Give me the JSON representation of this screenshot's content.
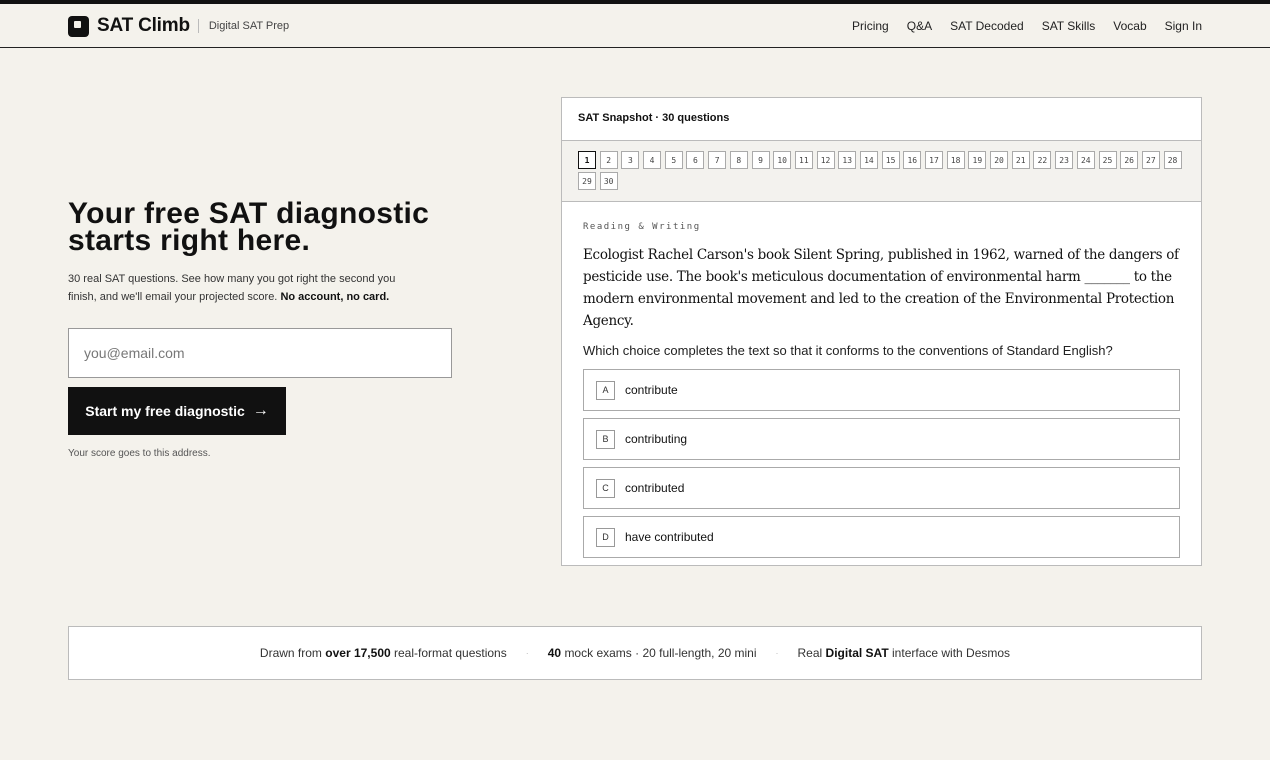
{
  "header": {
    "brand": "SAT Climb",
    "tagline": "Digital SAT Prep",
    "nav": [
      "Pricing",
      "Q&A",
      "SAT Decoded",
      "SAT Skills",
      "Vocab",
      "Sign In"
    ]
  },
  "hero": {
    "title": "Your free SAT diagnostic\nstarts right here.",
    "desc": "30 real SAT questions. See how many you got right the second you finish, and we'll email your projected score.",
    "desc_bold": "No account, no card.",
    "email_placeholder": "you@email.com",
    "cta_label": "Start my free diagnostic",
    "cta_arrow": "→",
    "hint": "Your score goes to this address."
  },
  "card": {
    "title": "SAT Snapshot · 30 questions",
    "questions": [
      "1",
      "2",
      "3",
      "4",
      "5",
      "6",
      "7",
      "8",
      "9",
      "10",
      "11",
      "12",
      "13",
      "14",
      "15",
      "16",
      "17",
      "18",
      "19",
      "20",
      "21",
      "22",
      "23",
      "24",
      "25",
      "26",
      "27",
      "28",
      "29",
      "30"
    ],
    "active_question": "1",
    "section": "Reading & Writing",
    "passage": "Ecologist Rachel Carson's book Silent Spring, published in 1962, warned of the dangers of pesticide use. The book's meticulous documentation of environmental harm _______ to the modern environmental movement and led to the creation of the Environmental Protection Agency.",
    "question": "Which choice completes the text so that it conforms to the conventions of Standard English?",
    "choices": [
      {
        "letter": "A",
        "text": "contribute"
      },
      {
        "letter": "B",
        "text": "contributing"
      },
      {
        "letter": "C",
        "text": "contributed"
      },
      {
        "letter": "D",
        "text": "have contributed"
      }
    ]
  },
  "stats": {
    "s1_pre": "Drawn from",
    "s1_bold": "over 17,500",
    "s1_post": "real-format questions",
    "s2_bold": "40",
    "s2_post": "mock exams · 20 full-length, 20 mini",
    "s3_pre": "Real",
    "s3_bold": "Digital SAT",
    "s3_post": "interface with Desmos",
    "separator": "·"
  }
}
